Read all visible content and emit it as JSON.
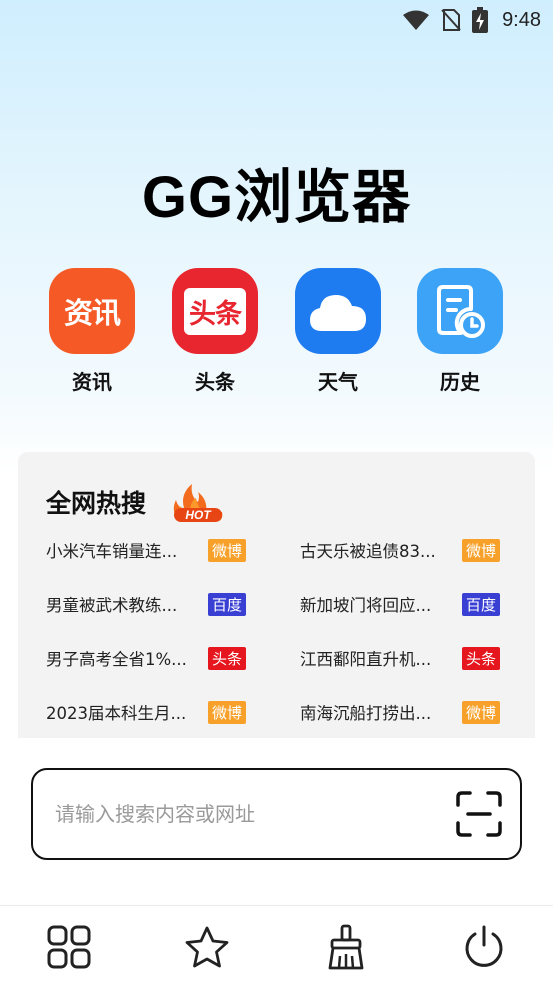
{
  "status_bar": {
    "time": "9:48"
  },
  "app": {
    "title": "GG浏览器"
  },
  "shortcuts": [
    {
      "label": "资讯",
      "tile_text": "资讯",
      "color": "#f55a26"
    },
    {
      "label": "头条",
      "tile_text": "头条",
      "color": "#e8262f"
    },
    {
      "label": "天气",
      "icon": "cloud-icon",
      "color": "#1e7cf0"
    },
    {
      "label": "历史",
      "icon": "history-document-icon",
      "color": "#3ca3f6"
    }
  ],
  "hot_search": {
    "title": "全网热搜",
    "badge": "HOT",
    "items": [
      {
        "text": "小米汽车销量连...",
        "source": "微博",
        "color": "#f7a12b"
      },
      {
        "text": "古天乐被追债83...",
        "source": "微博",
        "color": "#f7a12b"
      },
      {
        "text": "男童被武术教练...",
        "source": "百度",
        "color": "#3a3fd4"
      },
      {
        "text": "新加坡门将回应...",
        "source": "百度",
        "color": "#3a3fd4"
      },
      {
        "text": "男子高考全省1%...",
        "source": "头条",
        "color": "#e5161d"
      },
      {
        "text": "江西鄱阳直升机...",
        "source": "头条",
        "color": "#e5161d"
      },
      {
        "text": "2023届本科生月...",
        "source": "微博",
        "color": "#f7a12b"
      },
      {
        "text": "南海沉船打捞出...",
        "source": "微博",
        "color": "#f7a12b"
      }
    ]
  },
  "search": {
    "placeholder": "请输入搜索内容或网址",
    "scan_icon": "scan-icon"
  },
  "bottom_nav": [
    {
      "icon": "grid-icon"
    },
    {
      "icon": "star-icon"
    },
    {
      "icon": "broom-icon"
    },
    {
      "icon": "power-icon"
    }
  ]
}
